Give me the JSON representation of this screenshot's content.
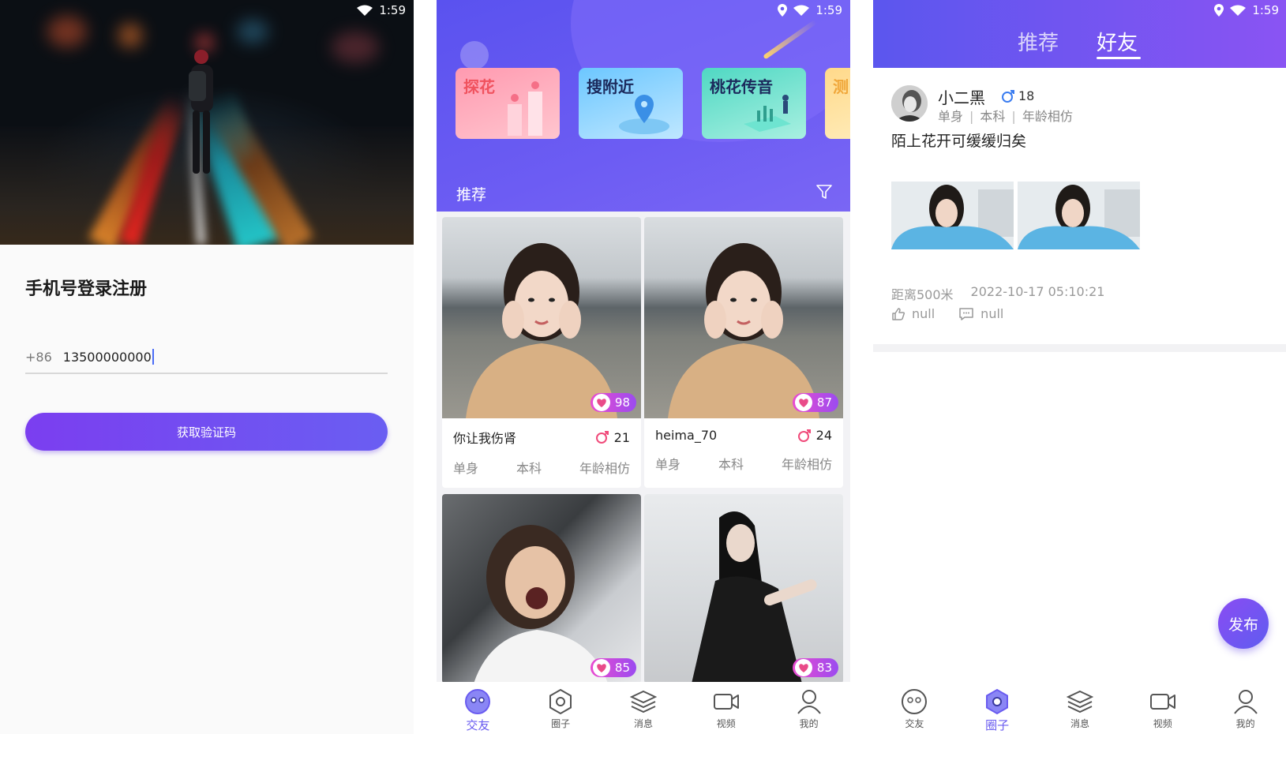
{
  "status": {
    "time": "1:59"
  },
  "login": {
    "title": "手机号登录注册",
    "prefix": "+86",
    "phone": "13500000000",
    "code_button": "获取验证码"
  },
  "home": {
    "features": [
      {
        "label": "探花",
        "color": "#f0525e"
      },
      {
        "label": "搜附近",
        "color": "#1c2a5c"
      },
      {
        "label": "桃花传音",
        "color": "#1c2a5c"
      },
      {
        "label": "测",
        "color": "#f0a73a"
      }
    ],
    "section_label": "推荐",
    "cards": [
      {
        "score": "98",
        "nickname": "你让我伤肾",
        "age": "21",
        "tags": [
          "单身",
          "本科",
          "年龄相仿"
        ]
      },
      {
        "score": "87",
        "nickname": "heima_70",
        "age": "24",
        "tags": [
          "单身",
          "本科",
          "年龄相仿"
        ]
      },
      {
        "score": "85"
      },
      {
        "score": "83"
      }
    ],
    "tabbar": [
      {
        "label": "交友",
        "icon": "face-icon",
        "active": true
      },
      {
        "label": "圈子",
        "icon": "hexagon-icon",
        "active": false
      },
      {
        "label": "消息",
        "icon": "layers-icon",
        "active": false
      },
      {
        "label": "视频",
        "icon": "video-icon",
        "active": false
      },
      {
        "label": "我的",
        "icon": "person-icon",
        "active": false
      }
    ]
  },
  "circle": {
    "top_tabs": [
      {
        "label": "推荐",
        "active": false
      },
      {
        "label": "好友",
        "active": true
      }
    ],
    "post": {
      "name": "小二黑",
      "age": "18",
      "tags": [
        "单身",
        "本科",
        "年龄相仿"
      ],
      "text": "陌上花开可缓缓归矣",
      "distance": "距离500米",
      "time": "2022-10-17 05:10:21",
      "likes": "null",
      "comments": "null"
    },
    "fab_label": "发布",
    "tabbar": [
      {
        "label": "交友",
        "icon": "face-icon",
        "active": false
      },
      {
        "label": "圈子",
        "icon": "hexagon-icon",
        "active": true
      },
      {
        "label": "消息",
        "icon": "layers-icon",
        "active": false
      },
      {
        "label": "视频",
        "icon": "video-icon",
        "active": false
      },
      {
        "label": "我的",
        "icon": "person-icon",
        "active": false
      }
    ]
  },
  "colors": {
    "accent": "#6a5cf0",
    "pink": "#e94bd0"
  }
}
